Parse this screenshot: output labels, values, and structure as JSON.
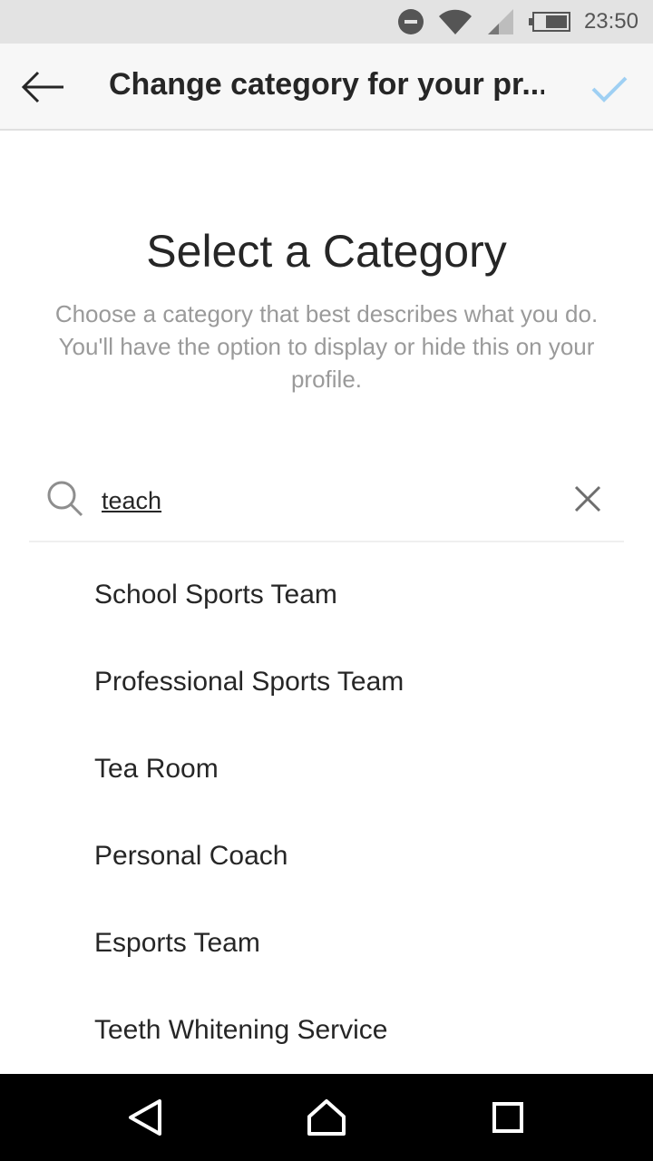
{
  "status_bar": {
    "time": "23:50",
    "icons": [
      "do-not-disturb-icon",
      "wifi-icon",
      "cell-signal-icon",
      "battery-icon"
    ]
  },
  "app_bar": {
    "title": "Change category for your pr...",
    "back_icon": "arrow-left-icon",
    "confirm_icon": "checkmark-icon"
  },
  "main": {
    "heading": "Select a Category",
    "subtitle": "Choose a category that best describes what you do. You'll have the option to display or hide this on your profile."
  },
  "search": {
    "value": "teach",
    "icon": "search-icon",
    "clear_icon": "close-icon"
  },
  "results": [
    "School Sports Team",
    "Professional Sports Team",
    "Tea Room",
    "Personal Coach",
    "Esports Team",
    "Teeth Whitening Service"
  ],
  "nav_bar": {
    "icons": [
      "back-triangle-icon",
      "home-icon",
      "recents-icon"
    ]
  },
  "colors": {
    "accent_disabled": "#9fd0f3",
    "text_primary": "#262626",
    "text_secondary": "#9a9a9a"
  }
}
